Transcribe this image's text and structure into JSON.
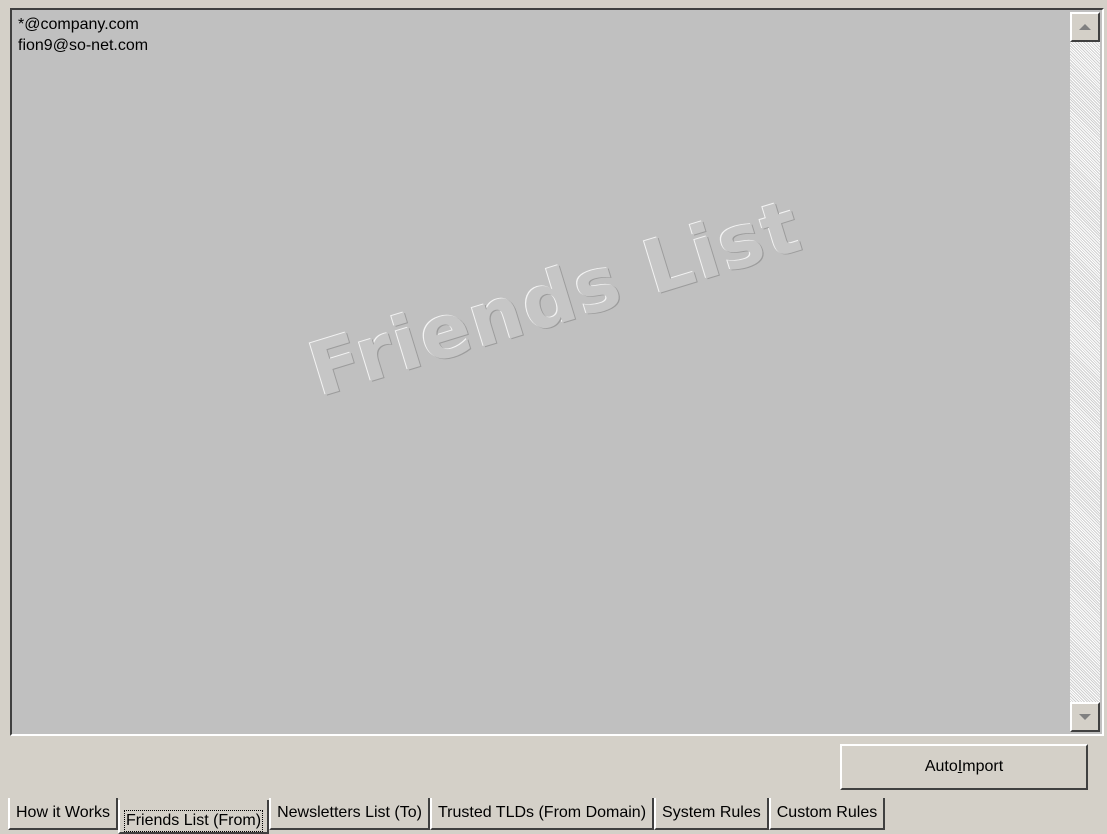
{
  "list": {
    "items": [
      "*@company.com",
      "fion9@so-net.com"
    ],
    "watermark": "Friends List"
  },
  "buttons": {
    "auto_import": {
      "label_before": "Auto ",
      "label_mnemonic": "I",
      "label_after": "mport"
    }
  },
  "tabs": [
    {
      "label": "How it Works",
      "active": false
    },
    {
      "label": "Friends List (From)",
      "active": true
    },
    {
      "label": "Newsletters List (To)",
      "active": false
    },
    {
      "label": "Trusted TLDs (From Domain)",
      "active": false
    },
    {
      "label": "System Rules",
      "active": false
    },
    {
      "label": "Custom Rules",
      "active": false
    }
  ],
  "icons": {
    "scroll_up": "scroll-up-arrow-icon",
    "scroll_down": "scroll-down-arrow-icon"
  }
}
